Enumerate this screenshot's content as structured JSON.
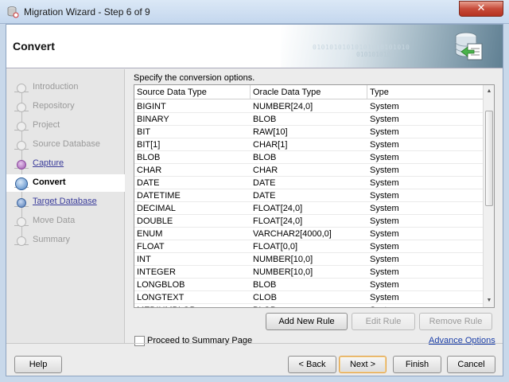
{
  "window": {
    "title": "Migration Wizard - Step 6 of 9",
    "close_glyph": "✕"
  },
  "header": {
    "title": "Convert",
    "art_text_1": "01010101010101010101010",
    "art_text_2": "0101010101"
  },
  "nav": {
    "items": [
      {
        "label": "Introduction",
        "state": "disabled"
      },
      {
        "label": "Repository",
        "state": "disabled"
      },
      {
        "label": "Project",
        "state": "disabled"
      },
      {
        "label": "Source Database",
        "state": "disabled"
      },
      {
        "label": "Capture",
        "state": "link"
      },
      {
        "label": "Convert",
        "state": "active"
      },
      {
        "label": "Target Database",
        "state": "link"
      },
      {
        "label": "Move Data",
        "state": "disabled"
      },
      {
        "label": "Summary",
        "state": "disabled"
      }
    ]
  },
  "main": {
    "instruction": "Specify the conversion options.",
    "table": {
      "columns": [
        "Source Data Type",
        "Oracle Data Type",
        "Type"
      ],
      "rows": [
        [
          "BIGINT",
          "NUMBER[24,0]",
          "System"
        ],
        [
          "BINARY",
          "BLOB",
          "System"
        ],
        [
          "BIT",
          "RAW[10]",
          "System"
        ],
        [
          "BIT[1]",
          "CHAR[1]",
          "System"
        ],
        [
          "BLOB",
          "BLOB",
          "System"
        ],
        [
          "CHAR",
          "CHAR",
          "System"
        ],
        [
          "DATE",
          "DATE",
          "System"
        ],
        [
          "DATETIME",
          "DATE",
          "System"
        ],
        [
          "DECIMAL",
          "FLOAT[24,0]",
          "System"
        ],
        [
          "DOUBLE",
          "FLOAT[24,0]",
          "System"
        ],
        [
          "ENUM",
          "VARCHAR2[4000,0]",
          "System"
        ],
        [
          "FLOAT",
          "FLOAT[0,0]",
          "System"
        ],
        [
          "INT",
          "NUMBER[10,0]",
          "System"
        ],
        [
          "INTEGER",
          "NUMBER[10,0]",
          "System"
        ],
        [
          "LONGBLOB",
          "BLOB",
          "System"
        ],
        [
          "LONGTEXT",
          "CLOB",
          "System"
        ],
        [
          "MEDIUMBLOB",
          "BLOB",
          "System"
        ]
      ]
    },
    "buttons": {
      "add_rule": "Add New Rule",
      "edit_rule": "Edit Rule",
      "remove_rule": "Remove Rule"
    },
    "proceed_checkbox": {
      "label": "Proceed to Summary Page",
      "checked": false
    },
    "advance_link": "Advance Options"
  },
  "footer": {
    "help": "Help",
    "back": "< Back",
    "next": "Next >",
    "finish": "Finish",
    "cancel": "Cancel"
  }
}
